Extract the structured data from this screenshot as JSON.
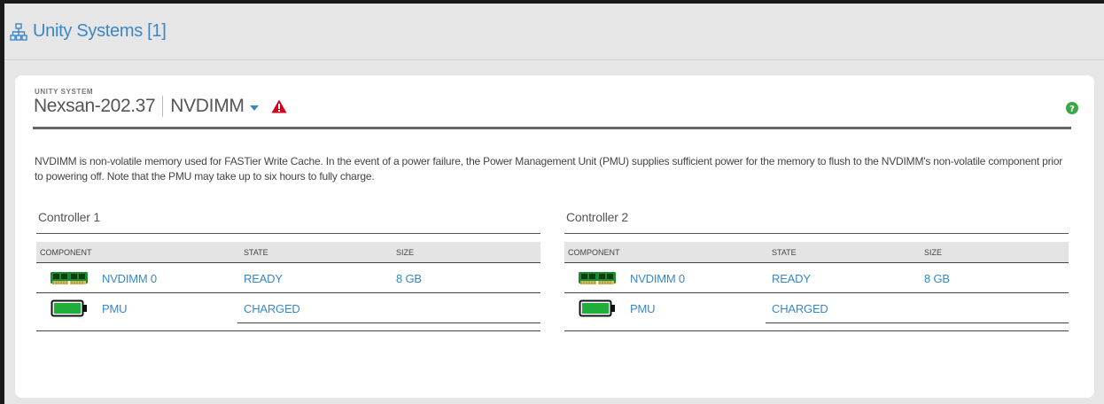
{
  "header": {
    "title": "Unity Systems [1]",
    "icon": "network-icon"
  },
  "system": {
    "label": "UNITY SYSTEM",
    "name": "Nexsan-202.37",
    "mode": "NVDIMM",
    "warning_icon": "warning-icon",
    "help_icon": "help-icon"
  },
  "description": "NVDIMM is non-volatile memory used for FASTier Write Cache. In the event of a power failure, the Power Management Unit (PMU) supplies sufficient power for the memory to flush to the NVDIMM's non-volatile component prior to powering off. Note that the PMU may take up to six hours to fully charge.",
  "columns": {
    "component": "COMPONENT",
    "state": "STATE",
    "size": "SIZE"
  },
  "controllers": [
    {
      "title": "Controller 1",
      "rows": [
        {
          "component": "NVDIMM 0",
          "state": "READY",
          "size": "8 GB",
          "icon": "memory-module-icon"
        },
        {
          "component": "PMU",
          "state": "CHARGED",
          "size": "",
          "icon": "battery-icon"
        }
      ]
    },
    {
      "title": "Controller 2",
      "rows": [
        {
          "component": "NVDIMM 0",
          "state": "READY",
          "size": "8 GB",
          "icon": "memory-module-icon"
        },
        {
          "component": "PMU",
          "state": "CHARGED",
          "size": "",
          "icon": "battery-icon"
        }
      ]
    }
  ],
  "colors": {
    "accent": "#3a87c8",
    "battery": "#1fae3a",
    "warning": "#d0021b",
    "help": "#3aa845"
  }
}
